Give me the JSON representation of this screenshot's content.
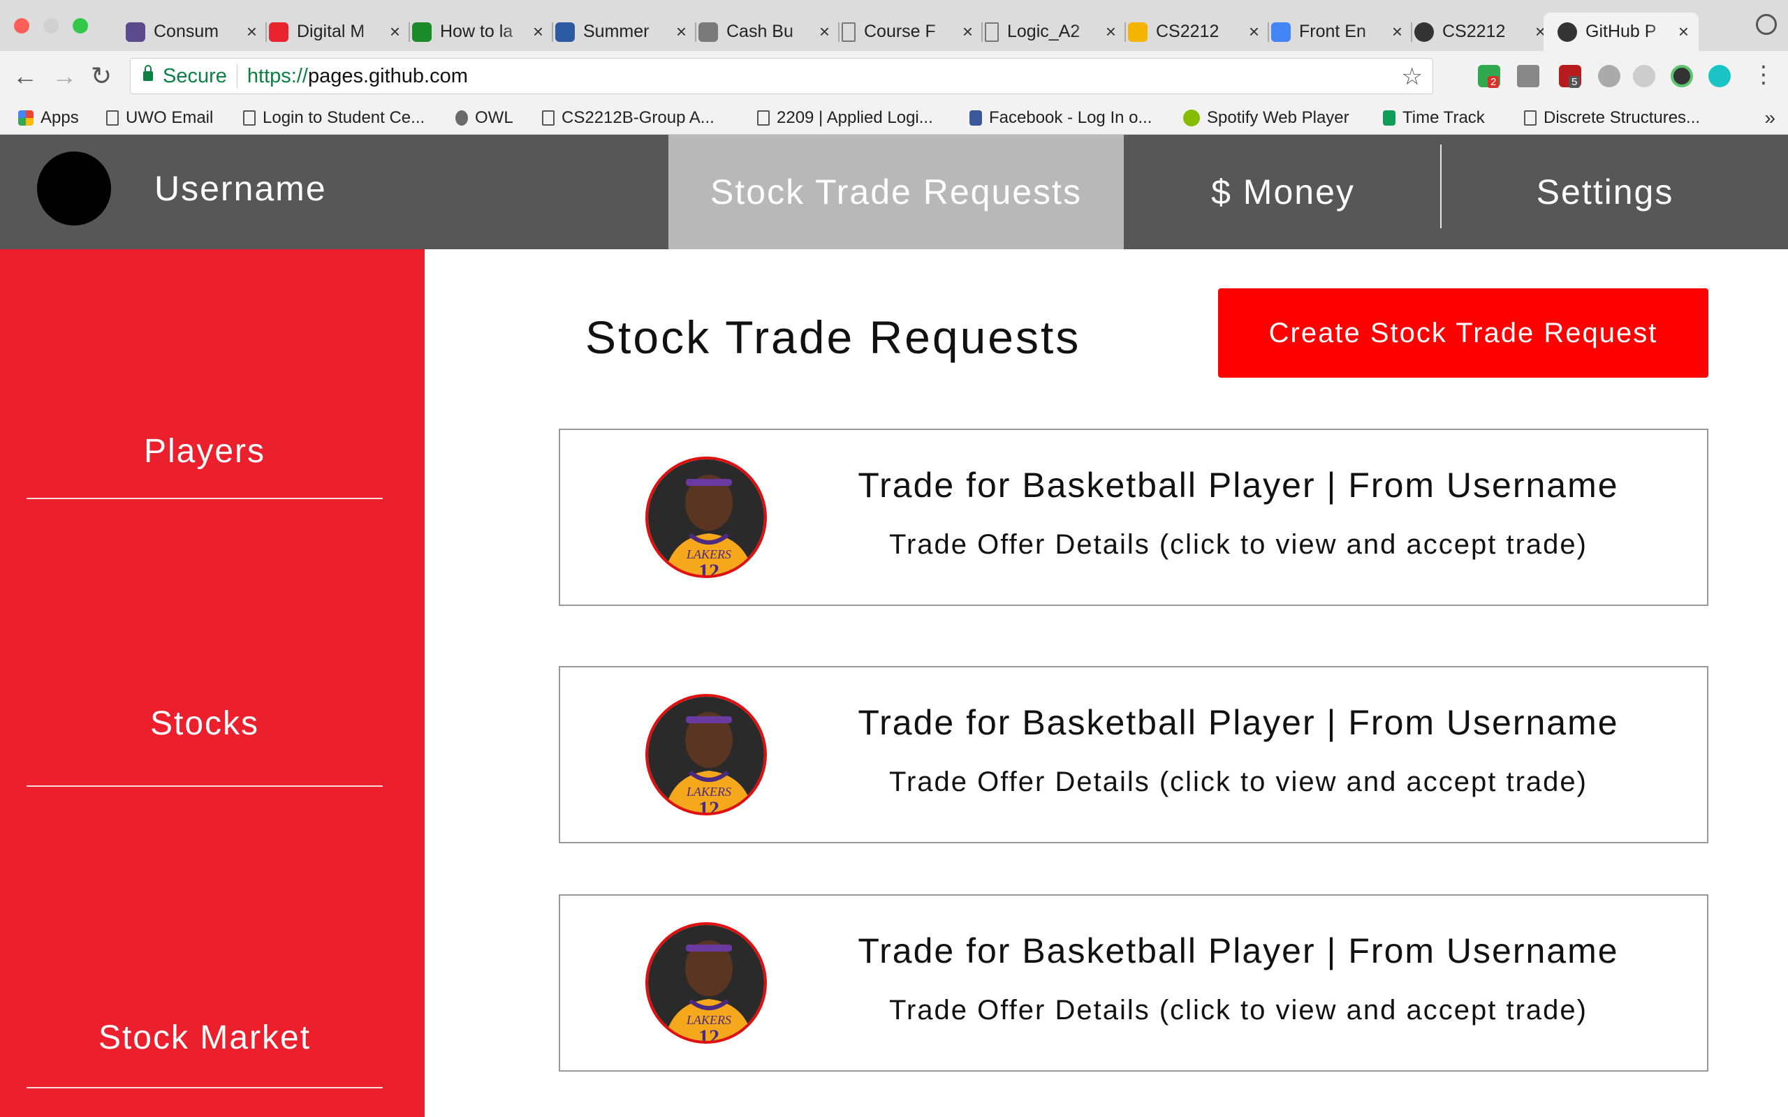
{
  "browser": {
    "tabs": [
      {
        "label": "Consum",
        "fav_color": "#5b4a8c"
      },
      {
        "label": "Digital M",
        "fav_color": "#e8252e"
      },
      {
        "label": "How to la",
        "fav_color": "#1b8a2a"
      },
      {
        "label": "Summer",
        "fav_color": "#2c5aa0"
      },
      {
        "label": "Cash Bu",
        "fav_color": "#7a7a7a"
      },
      {
        "label": "Course F",
        "fav_color": "#dcdcdc"
      },
      {
        "label": "Logic_A2",
        "fav_color": "#dcdcdc"
      },
      {
        "label": "CS2212",
        "fav_color": "#f4b400"
      },
      {
        "label": "Front En",
        "fav_color": "#4285f4"
      },
      {
        "label": "CS2212",
        "fav_color": "#333333"
      },
      {
        "label": "GitHub P",
        "fav_color": "#333333"
      }
    ],
    "tab_close_glyph": "×",
    "secure_label": "Secure",
    "url_scheme": "https://",
    "url_host": "pages.github.com",
    "ext_badges": [
      "2",
      "5"
    ],
    "bookmarks": [
      {
        "label": "Apps"
      },
      {
        "label": "UWO Email"
      },
      {
        "label": "Login to Student Ce..."
      },
      {
        "label": "OWL"
      },
      {
        "label": "CS2212B-Group A..."
      },
      {
        "label": "2209 | Applied Logi..."
      },
      {
        "label": "Facebook - Log In o..."
      },
      {
        "label": "Spotify Web Player"
      },
      {
        "label": "Time Track"
      },
      {
        "label": "Discrete Structures..."
      }
    ],
    "bookmarks_more": "»"
  },
  "header": {
    "username": "Username",
    "nav": [
      {
        "label": "Stock Trade Requests",
        "active": true
      },
      {
        "label": "$ Money",
        "active": false
      },
      {
        "label": "Settings",
        "active": false
      }
    ]
  },
  "sidebar": {
    "items": [
      {
        "label": "Players"
      },
      {
        "label": "Stocks"
      },
      {
        "label": "Stock Market"
      }
    ]
  },
  "main": {
    "title": "Stock Trade Requests",
    "create_button": "Create Stock Trade Request",
    "requests": [
      {
        "title": "Trade for Basketball Player | From Username",
        "details": "Trade Offer Details (click to view and accept trade)",
        "jersey_team": "LAKERS",
        "jersey_number": "12"
      },
      {
        "title": "Trade for Basketball Player | From Username",
        "details": "Trade Offer Details (click to view and accept trade)",
        "jersey_team": "LAKERS",
        "jersey_number": "12"
      },
      {
        "title": "Trade for Basketball Player | From Username",
        "details": "Trade Offer Details (click to view and accept trade)",
        "jersey_team": "LAKERS",
        "jersey_number": "12"
      }
    ]
  },
  "colors": {
    "sidebar_bg": "#ec1f2c",
    "header_bg": "#575757",
    "active_tab_bg": "#b8b8b8",
    "button_bg": "#ff0000"
  }
}
